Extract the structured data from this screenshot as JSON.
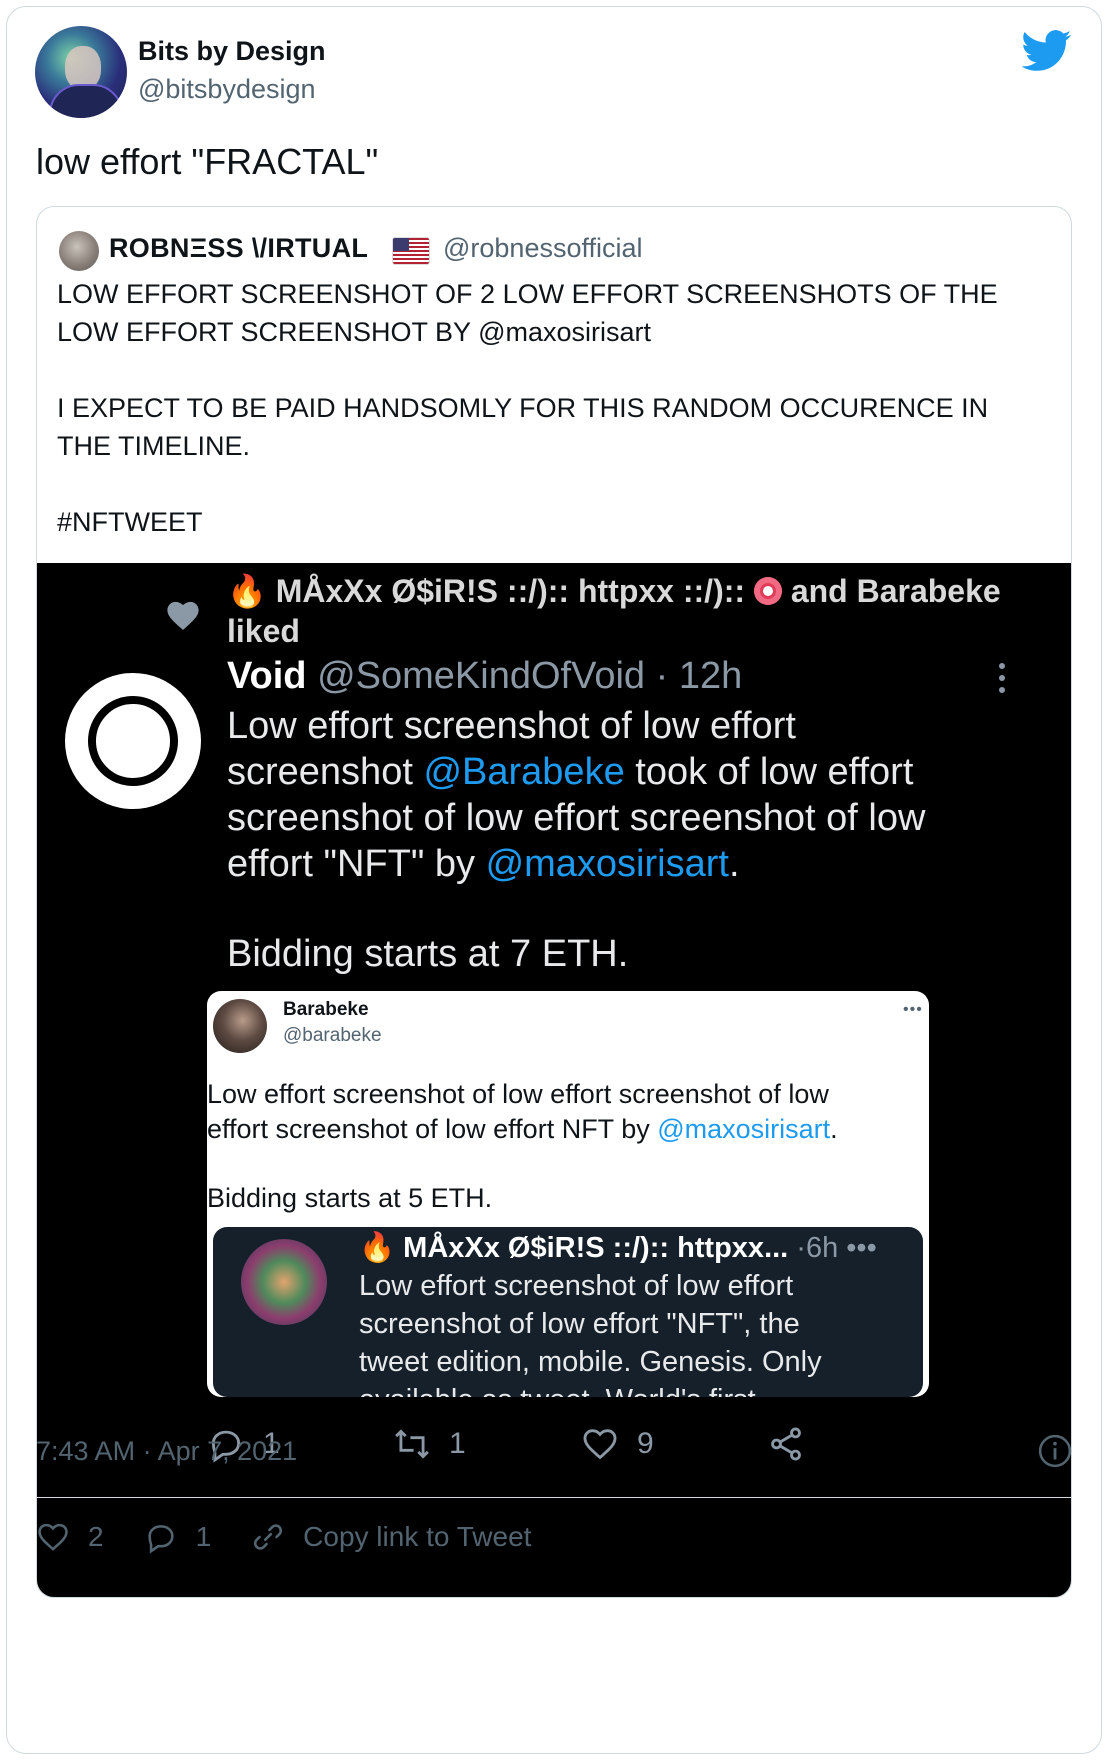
{
  "tweet": {
    "author": {
      "name": "Bits by Design",
      "handle": "@bitsbydesign"
    },
    "text": "low effort \"FRACTAL\"",
    "timestamp": "7:43 AM · Apr 7, 2021",
    "likes": "2",
    "replies": "1",
    "copy_link_label": "Copy link to Tweet"
  },
  "quoted": {
    "name": "ROBNΞSS \\/IRTUAL",
    "handle": "@robnessofficial",
    "lines": [
      "LOW EFFORT SCREENSHOT OF 2 LOW EFFORT SCREENSHOTS OF THE",
      "LOW EFFORT SCREENSHOT BY @maxosirisart",
      "I EXPECT TO BE PAID HANDSOMLY FOR THIS RANDOM OCCURENCE IN",
      "THE TIMELINE.",
      "#NFTWEET"
    ]
  },
  "screenshot": {
    "liked_prefix": "🔥 MÅxXx Ø$iR!S ::/):: httpxx ::/)::",
    "liked_suffix": "and Barabeke",
    "liked_line2": "liked",
    "void_name": "Void",
    "void_handle": "@SomeKindOfVoid · 12h",
    "void_line1": "Low effort screenshot of low effort",
    "void_line2a": "screenshot ",
    "void_line2_link": "@Barabeke",
    "void_line2b": " took of low effort",
    "void_line3": "screenshot of low effort screenshot of low",
    "void_line4a": "effort \"NFT\" by ",
    "void_line4_link": "@maxosirisart",
    "void_line4b": ".",
    "void_line5": "Bidding starts at 7 ETH.",
    "embed": {
      "name": "Barabeke",
      "handle": "@barabeke",
      "dots": "•••",
      "line1": "Low effort screenshot of low effort screenshot of low",
      "line2a": "effort screenshot of low effort NFT by ",
      "line2_link": "@maxosirisart",
      "line2b": ".",
      "line3": "Bidding starts at 5 ETH.",
      "inner": {
        "name": "🔥 MÅxXx Ø$iR!S ::/):: httpxx...",
        "time": " ·6h •••",
        "line1": "Low effort screenshot of low effort",
        "line2": "screenshot of low effort \"NFT\", the",
        "line3": "tweet edition, mobile. Genesis. Only",
        "line4": "available as tweet. World's first"
      }
    },
    "actions": {
      "replies": "1",
      "retweets": "1",
      "likes": "9"
    }
  }
}
